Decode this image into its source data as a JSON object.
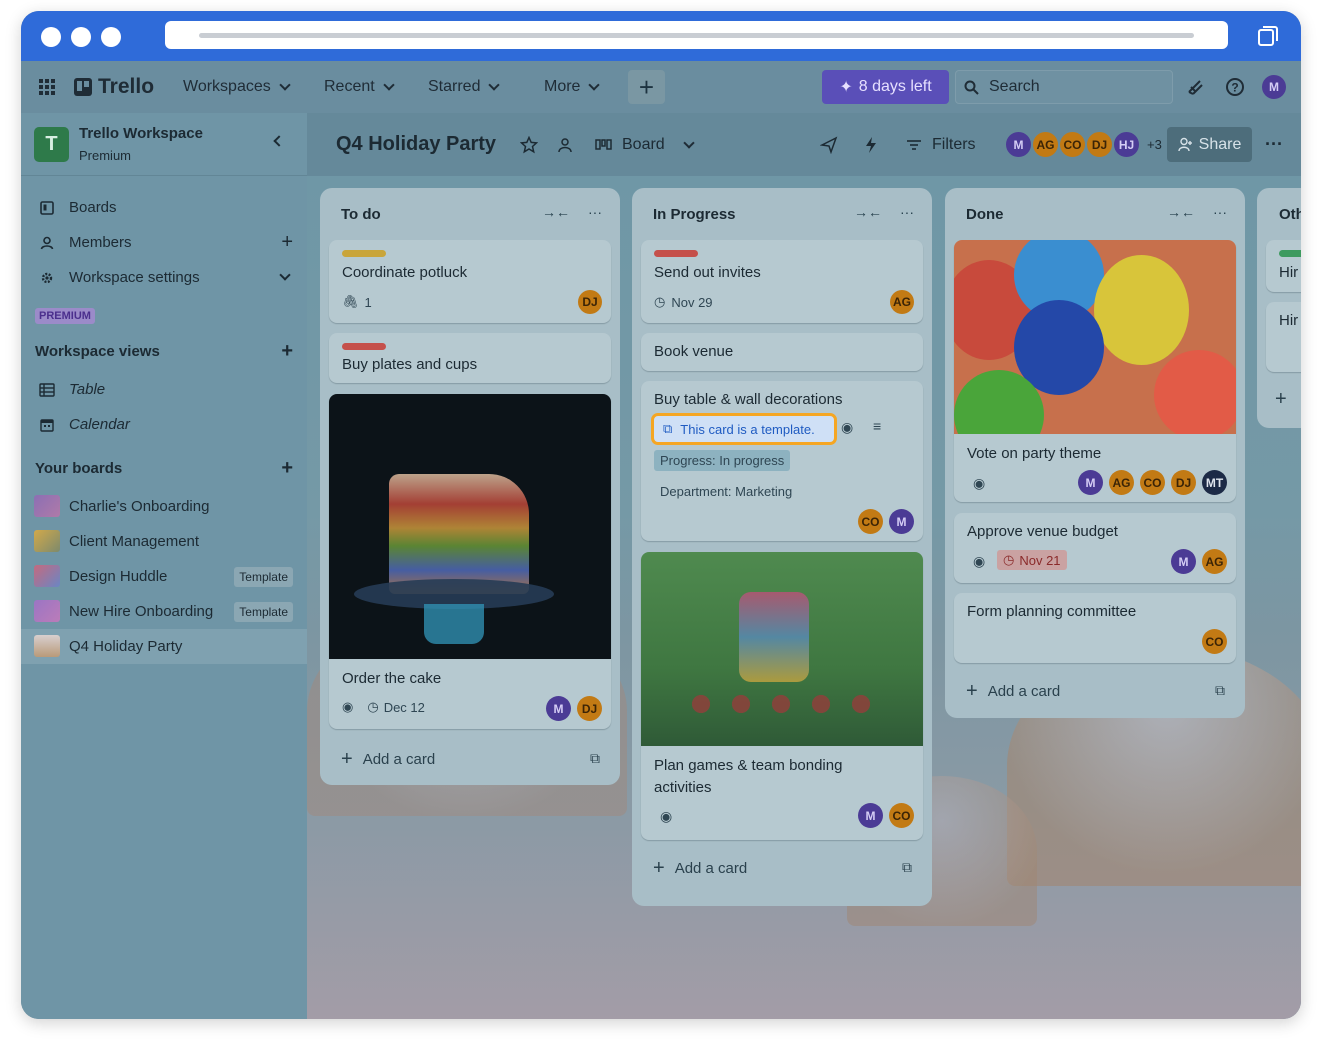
{
  "nav": {
    "logo": "Trello",
    "workspaces": "Workspaces",
    "recent": "Recent",
    "starred": "Starred",
    "more": "More",
    "create": "+",
    "trial": "8 days left",
    "search_placeholder": "Search",
    "user_initial": "M"
  },
  "sidebar": {
    "workspace_initial": "T",
    "workspace_name": "Trello Workspace",
    "workspace_plan": "Premium",
    "items": [
      {
        "label": "Boards"
      },
      {
        "label": "Members"
      },
      {
        "label": "Workspace settings"
      }
    ],
    "premium_badge": "PREMIUM",
    "views_heading": "Workspace views",
    "views": [
      {
        "label": "Table"
      },
      {
        "label": "Calendar"
      }
    ],
    "boards_heading": "Your boards",
    "boards": [
      {
        "label": "Charlie's Onboarding",
        "template": ""
      },
      {
        "label": "Client Management",
        "template": ""
      },
      {
        "label": "Design Huddle",
        "template": "Template"
      },
      {
        "label": "New Hire Onboarding",
        "template": "Template"
      },
      {
        "label": "Q4 Holiday Party",
        "template": ""
      }
    ]
  },
  "board": {
    "title": "Q4 Holiday Party",
    "view": "Board",
    "filters": "Filters",
    "members": [
      "M",
      "AG",
      "CO",
      "DJ",
      "HJ"
    ],
    "extra_members": "+3",
    "share": "Share",
    "more": "···"
  },
  "lists": {
    "todo": {
      "title": "To do",
      "cards": [
        {
          "title": "Coordinate potluck",
          "attachments": "1",
          "members": [
            "DJ"
          ]
        },
        {
          "title": "Buy plates and cups"
        },
        {
          "title": "Order the cake",
          "date": "Dec 12",
          "members": [
            "M",
            "DJ"
          ]
        }
      ],
      "add": "Add a card"
    },
    "inprogress": {
      "title": "In Progress",
      "cards": [
        {
          "title": "Send out invites",
          "date": "Nov 29",
          "members": [
            "AG"
          ]
        },
        {
          "title": "Book venue"
        },
        {
          "title": "Buy table & wall decorations",
          "template_notice": "This card is a template.",
          "field1": "Progress: In progress",
          "field2": "Department: Marketing",
          "members": [
            "CO",
            "M"
          ]
        },
        {
          "title": "Plan games & team bonding activities",
          "members": [
            "M",
            "CO"
          ]
        }
      ],
      "add": "Add a card"
    },
    "done": {
      "title": "Done",
      "cards": [
        {
          "title": "Vote on party theme",
          "members": [
            "M",
            "AG",
            "CO",
            "DJ",
            "MT"
          ]
        },
        {
          "title": "Approve venue budget",
          "date": "Nov 21",
          "members": [
            "M",
            "AG"
          ]
        },
        {
          "title": "Form planning committee",
          "members": [
            "CO"
          ]
        }
      ],
      "add": "Add a card"
    },
    "other": {
      "title": "Oth",
      "cards": [
        {
          "title": "Hir"
        },
        {
          "title": "Hir"
        }
      ]
    }
  },
  "colors": {
    "label_yellow": "#c9a53a",
    "label_red": "#c5504b",
    "label_green": "#3d9a5f",
    "highlight": "#f5a623"
  }
}
